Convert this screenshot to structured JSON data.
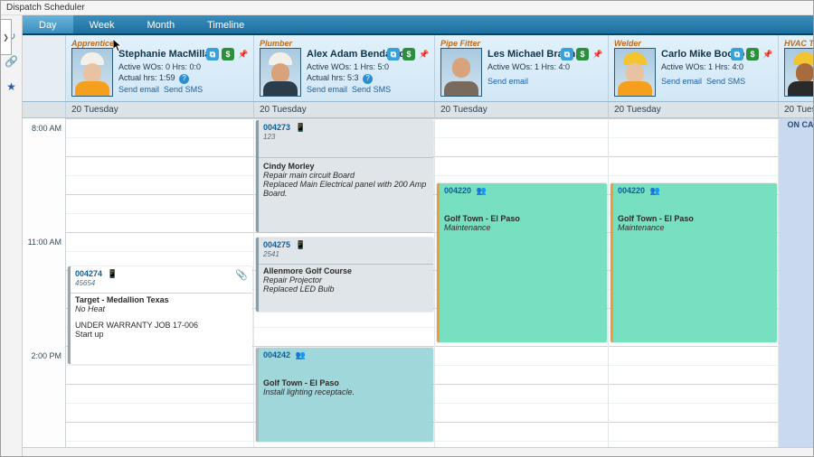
{
  "windowTitle": "Dispatch Scheduler",
  "tabs": {
    "day": "Day",
    "week": "Week",
    "month": "Month",
    "timeline": "Timeline"
  },
  "timeLabels": {
    "t8": "8:00 AM",
    "t11": "11:00 AM",
    "t14": "2:00 PM"
  },
  "dayHeader": "20 Tuesday",
  "links": {
    "email": "Send email",
    "sms": "Send SMS"
  },
  "oncall": "ON CALL",
  "resources": [
    {
      "role": "Apprentice",
      "name": "Stephanie MacMillan",
      "wo": "Active WOs: 0 Hrs: 0:0",
      "hrs": "Actual hrs: 1:59"
    },
    {
      "role": "Plumber",
      "name": "Alex Adam Bendavid",
      "wo": "Active WOs: 1 Hrs: 5:0",
      "hrs": "Actual hrs: 5:3"
    },
    {
      "role": "Pipe Fitter",
      "name": "Les Michael Braun",
      "wo": "Active WOs: 1 Hrs: 4:0",
      "hrs": ""
    },
    {
      "role": "Welder",
      "name": "Carlo Mike Bocco",
      "wo": "Active WOs: 1 Hrs: 4:0",
      "hrs": ""
    },
    {
      "role": "HVAC Tech",
      "name": "",
      "wo": "",
      "hrs": ""
    }
  ],
  "appts": {
    "a1": {
      "wo": "004273",
      "sub": "123",
      "client": "Cindy Morley",
      "l1": "Repair main circuit Board",
      "l2": "Replaced Main Electrical panel with 200 Amp Board."
    },
    "a2": {
      "wo": "004220",
      "client": "Golf Town - El Paso",
      "l1": "Maintenance"
    },
    "a3": {
      "wo": "004220",
      "client": "Golf Town - El Paso",
      "l1": "Maintenance"
    },
    "a4": {
      "wo": "004275",
      "sub": "2541",
      "client": "Allenmore Golf Course",
      "l1": "Repair Projector",
      "l2": "Replaced LED Bulb"
    },
    "a5": {
      "wo": "004274",
      "sub": "45654",
      "client": "Target - Medallion Texas",
      "l1": "No Heat",
      "l2": "UNDER WARRANTY JOB 17-006",
      "l3": "Start up"
    },
    "a6": {
      "wo": "004242",
      "client": "Golf Town - El Paso",
      "l1": "Install lighting receptacle."
    }
  }
}
